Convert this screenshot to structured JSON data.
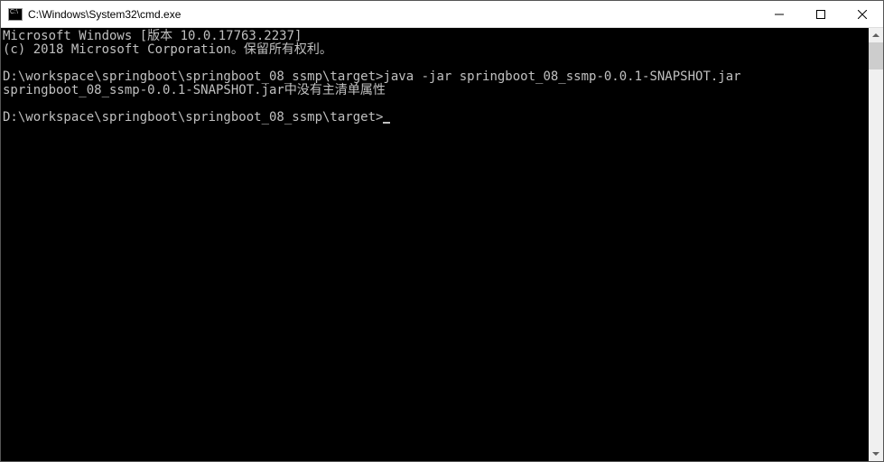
{
  "titlebar": {
    "title": "C:\\Windows\\System32\\cmd.exe"
  },
  "terminal": {
    "line1": "Microsoft Windows [版本 10.0.17763.2237]",
    "line2": "(c) 2018 Microsoft Corporation。保留所有权利。",
    "line3_prompt": "D:\\workspace\\springboot\\springboot_08_ssmp\\target>",
    "line3_cmd": "java -jar springboot_08_ssmp-0.0.1-SNAPSHOT.jar",
    "line4": "springboot_08_ssmp-0.0.1-SNAPSHOT.jar中没有主清单属性",
    "line5_prompt": "D:\\workspace\\springboot\\springboot_08_ssmp\\target>"
  }
}
